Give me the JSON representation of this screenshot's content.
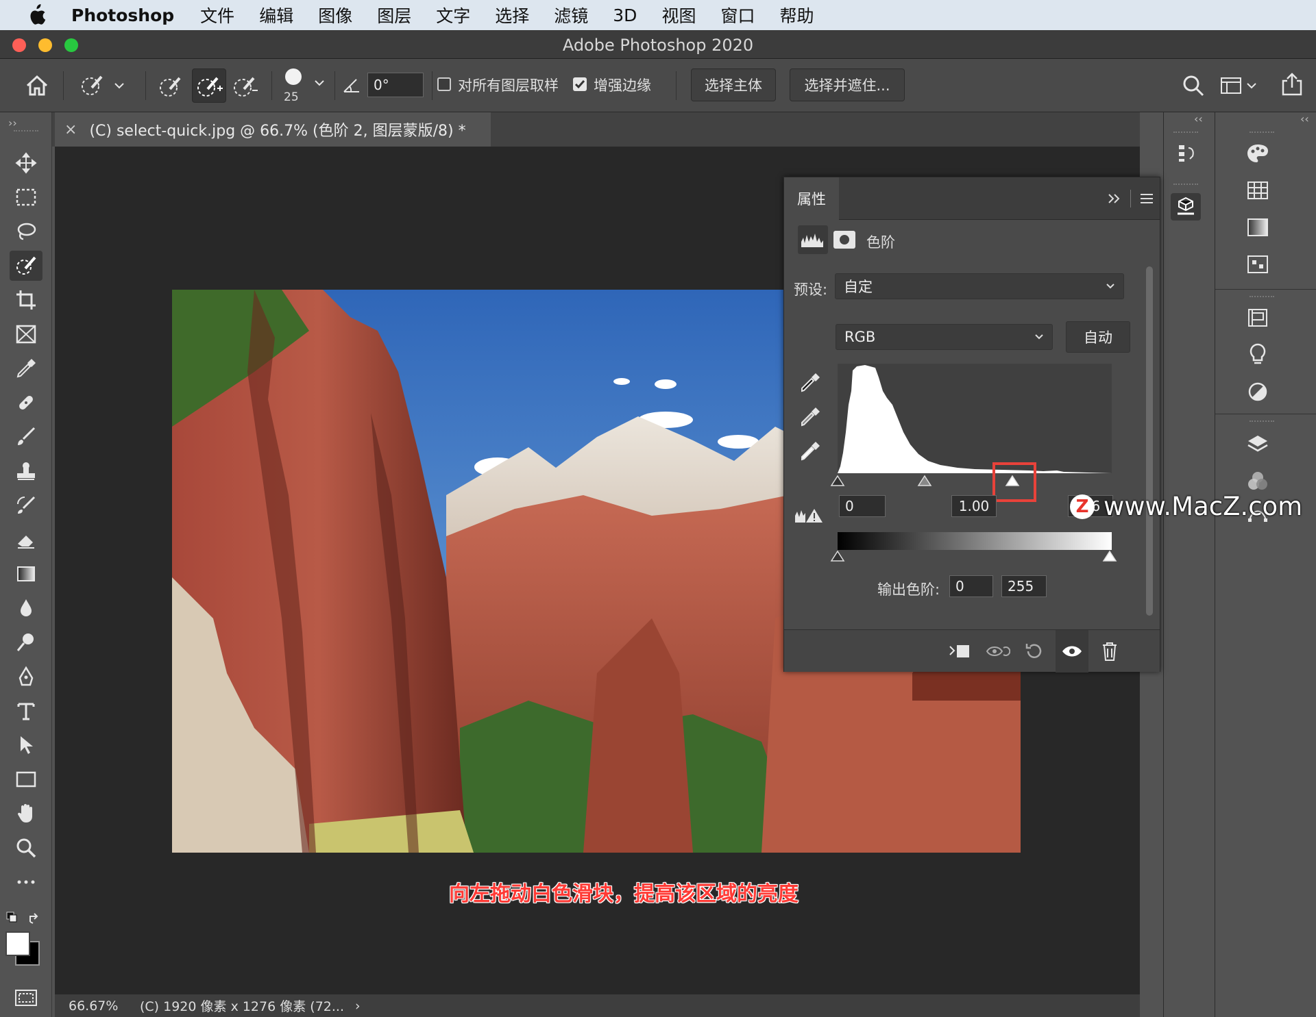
{
  "menubar": {
    "app": "Photoshop",
    "items": [
      "文件",
      "编辑",
      "图像",
      "图层",
      "文字",
      "选择",
      "滤镜",
      "3D",
      "视图",
      "窗口",
      "帮助"
    ]
  },
  "window": {
    "title": "Adobe Photoshop 2020"
  },
  "options": {
    "brush_size": "25",
    "angle": "0°",
    "sample_all_layers": {
      "label": "对所有图层取样",
      "checked": false
    },
    "enhance_edge": {
      "label": "增强边缘",
      "checked": true
    },
    "select_subject_label": "选择主体",
    "select_and_mask_label": "选择并遮住..."
  },
  "document": {
    "tab_title": "(C) select-quick.jpg @ 66.7% (色阶 2, 图层蒙版/8) *",
    "close": "×"
  },
  "status": {
    "zoom": "66.67%",
    "info": "(C) 1920 像素 x 1276 像素 (72...",
    "arrow": "›"
  },
  "properties": {
    "tab": "属性",
    "adjustment_name": "色阶",
    "preset_label": "预设:",
    "preset_value": "自定",
    "channel_value": "RGB",
    "auto_label": "自动",
    "input_black": "0",
    "input_gamma": "1.00",
    "input_white": "256",
    "output_label": "输出色阶:",
    "output_black": "0",
    "output_white": "255"
  },
  "annotation": "向左拖动白色滑块，提高该区域的亮度",
  "watermark": "www.MacZ.com",
  "colors": {
    "menubar": "#dde6ef",
    "panel": "#4a4a4a",
    "canvas": "#282828",
    "highlight": "#e8423a",
    "annotation": "#ff3a35"
  }
}
